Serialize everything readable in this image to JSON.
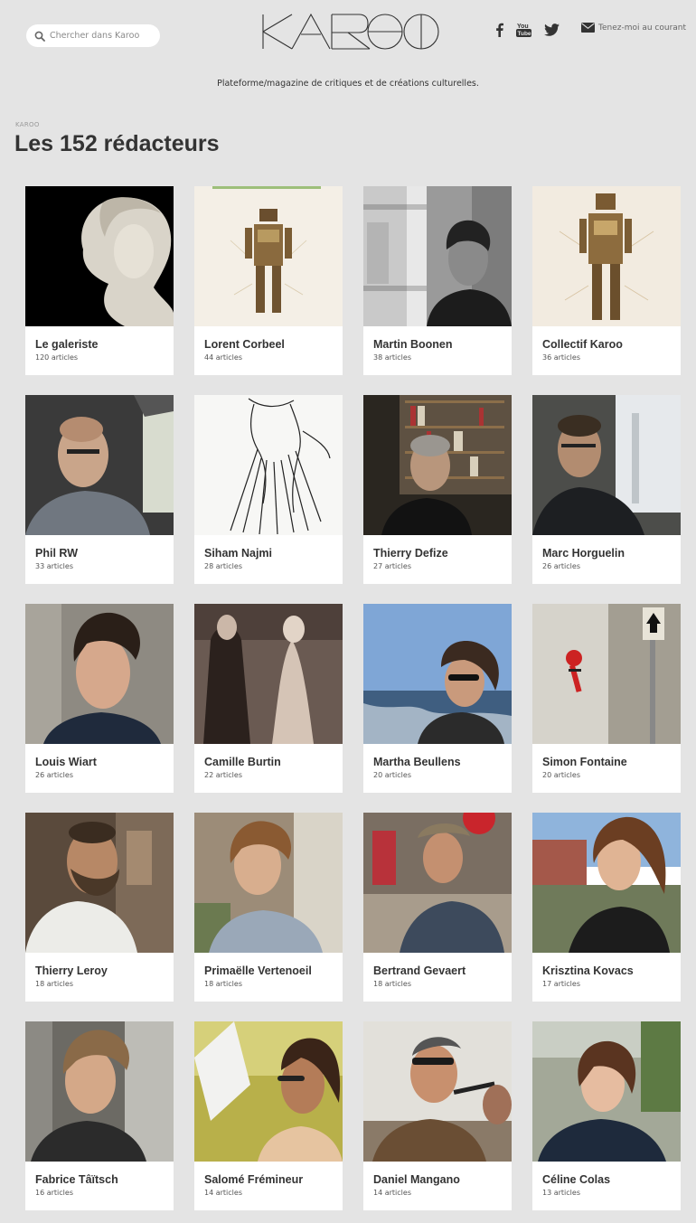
{
  "header": {
    "search_placeholder": "Chercher dans Karoo",
    "logo_text": "KAROO",
    "newsletter_label": "Tenez-moi au courant",
    "tagline": "Plateforme/magazine de critiques et de créations culturelles."
  },
  "breadcrumb": "KAROO",
  "page_title": "Les 152 rédacteurs",
  "authors": [
    {
      "name": "Le galeriste",
      "count": "120 articles"
    },
    {
      "name": "Lorent Corbeel",
      "count": "44 articles"
    },
    {
      "name": "Martin Boonen",
      "count": "38 articles"
    },
    {
      "name": "Collectif Karoo",
      "count": "36 articles"
    },
    {
      "name": "Phil RW",
      "count": "33 articles"
    },
    {
      "name": "Siham Najmi",
      "count": "28 articles"
    },
    {
      "name": "Thierry Defize",
      "count": "27 articles"
    },
    {
      "name": "Marc Horguelin",
      "count": "26 articles"
    },
    {
      "name": "Louis Wiart",
      "count": "26 articles"
    },
    {
      "name": "Camille Burtin",
      "count": "22 articles"
    },
    {
      "name": "Martha Beullens",
      "count": "20 articles"
    },
    {
      "name": "Simon Fontaine",
      "count": "20 articles"
    },
    {
      "name": "Thierry Leroy",
      "count": "18 articles"
    },
    {
      "name": "Primaëlle Vertenoeil",
      "count": "18 articles"
    },
    {
      "name": "Bertrand Gevaert",
      "count": "18 articles"
    },
    {
      "name": "Krisztina Kovacs",
      "count": "17 articles"
    },
    {
      "name": "Fabrice Tâïtsch",
      "count": "16 articles"
    },
    {
      "name": "Salomé Frémineur",
      "count": "14 articles"
    },
    {
      "name": "Daniel Mangano",
      "count": "14 articles"
    },
    {
      "name": "Céline Colas",
      "count": "13 articles"
    }
  ]
}
